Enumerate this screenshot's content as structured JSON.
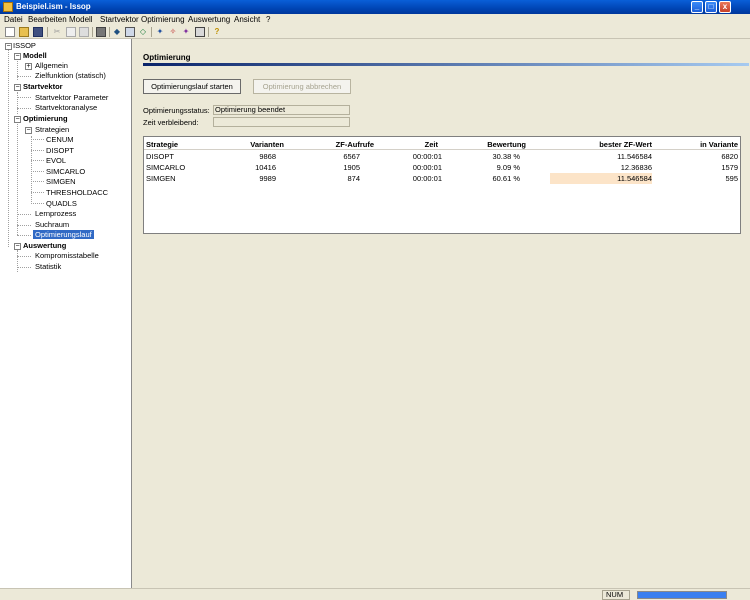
{
  "window": {
    "title": "Beispiel.ism - Issop",
    "min_glyph": "_",
    "max_glyph": "□",
    "close_glyph": "x"
  },
  "menu": [
    "Datei",
    "Bearbeiten",
    "Modell",
    "Startvektor",
    "Optimierung",
    "Auswertung",
    "Ansicht",
    "?"
  ],
  "toolbar": {
    "icons": [
      "new-file-icon",
      "open-folder-icon",
      "save-icon",
      "cut-icon",
      "copy-icon",
      "paste-icon",
      "print-icon",
      "model-icon",
      "startvector-icon",
      "optimize-icon",
      "run-icon",
      "results-icon",
      "statistics-icon",
      "table-icon",
      "help-icon"
    ]
  },
  "tree": {
    "root": "ISSOP",
    "modell": "Modell",
    "allgemein": "Allgemein",
    "zielfunktion": "Zielfunktion (statisch)",
    "startvektor": "Startvektor",
    "sv_parameter": "Startvektor Parameter",
    "sv_analyse": "Startvektoranalyse",
    "optimierung": "Optimierung",
    "strategien": "Strategien",
    "strategy_items": [
      "CENUM",
      "DISOPT",
      "EVOL",
      "SIMCARLO",
      "SIMGEN",
      "THRESHOLDACC",
      "QUADLS"
    ],
    "lernprozess": "Lernprozess",
    "suchraum": "Suchraum",
    "optimierungslauf": "Optimierungslauf",
    "auswertung": "Auswertung",
    "kompromiss": "Kompromisstabelle",
    "statistik": "Statistik",
    "exp_minus": "−",
    "exp_plus": "+"
  },
  "main": {
    "title": "Optimierung",
    "start_button": "Optimierungslauf starten",
    "abort_button": "Optimierung abbrechen",
    "status_label": "Optimierungsstatus:",
    "status_value": "Optimierung beendet",
    "time_label": "Zeit verbleibend:",
    "time_value": ""
  },
  "table": {
    "headers": [
      "Strategie",
      "Varianten",
      "ZF-Aufrufe",
      "Zeit",
      "Bewertung",
      "bester ZF-Wert",
      "in Variante"
    ],
    "rows": [
      [
        "DISOPT",
        "9868",
        "6567",
        "00:00:01",
        "30.38 %",
        "11.546584",
        "6820"
      ],
      [
        "SIMCARLO",
        "10416",
        "1905",
        "00:00:01",
        "9.09 %",
        "12.36836",
        "1579"
      ],
      [
        "SIMGEN",
        "9989",
        "874",
        "00:00:01",
        "60.61 %",
        "11.546584",
        "595"
      ]
    ],
    "highlight_color": "#fce4c8"
  },
  "statusbar": {
    "num": "NUM",
    "progress": 1.0
  }
}
